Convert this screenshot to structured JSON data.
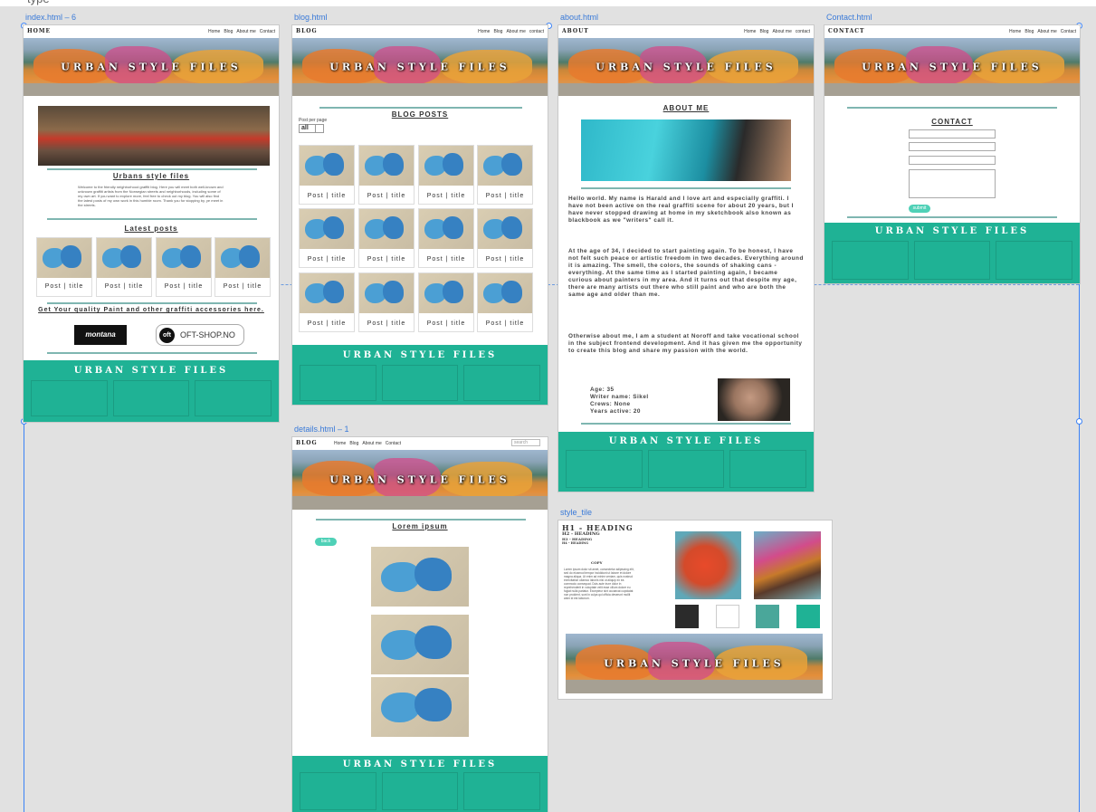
{
  "crop_text": "type",
  "artboards": {
    "index": "index.html – 6",
    "blog": "blog.html",
    "about": "about.html",
    "contact": "Contact.html",
    "details": "details.html – 1",
    "style": "style_tile"
  },
  "brand": {
    "hero_title": "URBAN STYLE FILES",
    "accent": "#1fb295",
    "divider": "#7fb6b1",
    "button": "#4fd1b7"
  },
  "nav": {
    "home": "Home",
    "blog": "Blog",
    "about": "About me",
    "contact": "Contact",
    "contact_lower": "contact",
    "search_placeholder": "search"
  },
  "index": {
    "page_label": "HOME",
    "intro_heading": "Urbans style files",
    "intro_text": "Welcome to the friendly neighborhood graffiti blog. Here you will meet both well-known and unknown graffiti artists from the Norwegian streets and neighborhoods, including some of my own art. If you want to explore more, feel free to check out my blog. You will also find the latest posts of my own work in this humble room. Thank you for stopping by, ye meet in the streets.",
    "latest_heading": "Latest posts",
    "post_caption": "Post | title",
    "shop_text": "Get Your quality Paint and other graffiti accessories here.",
    "logo_montana": "montana",
    "logo_oft": "OFT-SHOP.NO"
  },
  "blog": {
    "page_label": "BLOG",
    "heading": "BLOG POSTS",
    "filter_label": "Post per page",
    "filter_value": "all",
    "post_caption": "Post | title"
  },
  "about": {
    "page_label": "ABOUT",
    "heading": "ABOUT ME",
    "p1": "Hello world. My name is Harald and I love art and especially graffiti. I have not been active on the real graffiti scene for about 20 years, but I have never stopped drawing at home in my sketchbook also known as blackbook as we \"writers\" call it.",
    "p2": "At the age of 34, I decided to start painting again. To be honest, I have not felt such peace or artistic freedom in two decades. Everything around it is amazing. The smell, the colors, the sounds of shaking cans - everything. At the same time as I started painting again, I became curious about painters in my area. And it turns out that despite my age, there are many artists out there who still paint and who are both the same age and older than me.",
    "p3": "Otherwise about me, I am a student at Noroff and take vocational school in the subject frontend development. And it has given me the opportunity to create this blog and share my passion with the world.",
    "age": "Age: 35",
    "writer": "Writer name: Sikel",
    "crews": "Crews: None",
    "years": "Years active: 20"
  },
  "contact": {
    "page_label": "CONTACT",
    "heading": "CONTACT",
    "submit": "submit"
  },
  "details": {
    "page_label": "BLOG",
    "heading": "Lorem ipsum",
    "back": "back"
  },
  "style_tile": {
    "h1": "H1 - HEADING",
    "h2": "H2 - HEADING",
    "h3": "H3 - HEADING",
    "h4": "H4 - HEADING",
    "copy_label": "COPY",
    "copy_text": "Lorem ipsum dolor sit amet, consectetur adipiscing elit, sed do eiusmod tempor incididunt ut labore et dolore magna aliqua. Ut enim ad minim veniam, quis nostrud exercitation ullamco laboris nisi ut aliquip ex ea commodo consequat. Duis aute irure dolor in reprehenderit in voluptate velit esse cillum dolore eu fugiat nulla pariatur. Excepteur sint occaecat cupidatat non proident, sunt in culpa qui officia deserunt mollit anim id est laborum.",
    "swatches": [
      "#2b2b2b",
      "#ffffff",
      "#4aa79a",
      "#1fb295"
    ]
  }
}
